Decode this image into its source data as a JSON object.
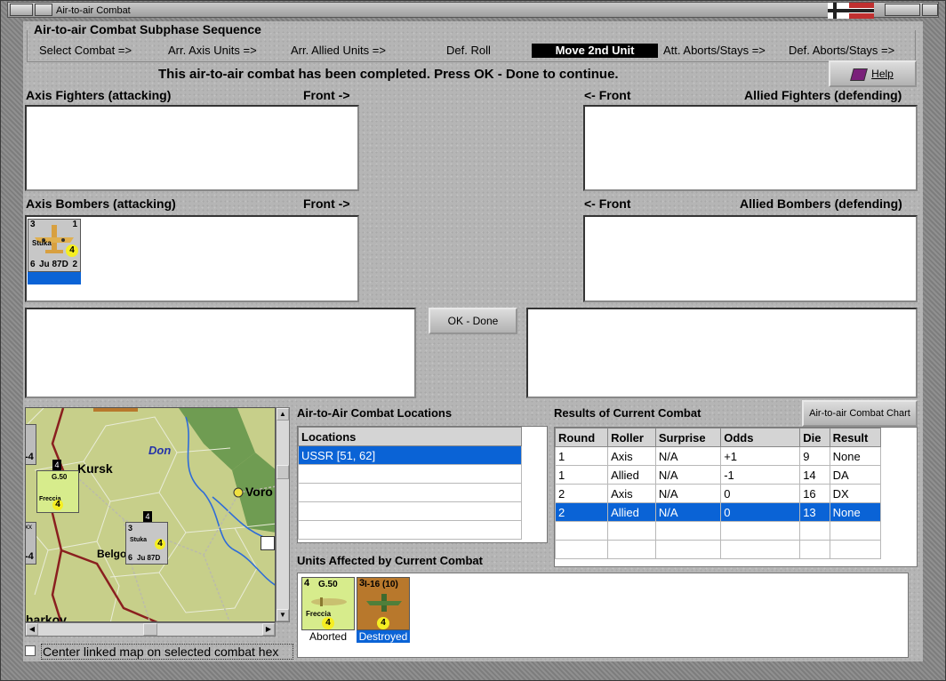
{
  "window": {
    "title": "Air-to-air Combat"
  },
  "sequence": {
    "heading": "Air-to-air Combat Subphase Sequence",
    "steps": [
      "Select Combat =>",
      "Arr. Axis Units =>",
      "Arr. Allied Units =>",
      "Def. Roll",
      "Move 2nd Unit",
      "Att. Aborts/Stays =>",
      "Def. Aborts/Stays =>"
    ],
    "active_step": "Move 2nd Unit"
  },
  "status_message": "This air-to-air combat has been completed.  Press OK - Done to continue.",
  "help_label": "Help",
  "panels": {
    "axis_fighters": "Axis Fighters (attacking)",
    "axis_bombers": "Axis Bombers (attacking)",
    "allied_fighters": "Allied Fighters (defending)",
    "allied_bombers": "Allied Bombers (defending)",
    "front_right": "Front ->",
    "front_left": "<- Front"
  },
  "axis_bomber_unit": {
    "class": "Stuka",
    "name": "Ju 87D",
    "top_left": "3",
    "top_right": "1",
    "bottom_left": "6",
    "bottom_right": "2",
    "value": "4"
  },
  "ok_done_label": "OK - Done",
  "map": {
    "labels": {
      "kursk": "Kursk",
      "don": "Don",
      "voro": "Voro",
      "belgo": "Belgo",
      "kharkov": "harkov"
    },
    "hex_counter_1": {
      "name": "G.50",
      "sub": "Freccia",
      "num": "4",
      "corner": "4"
    },
    "hex_counter_2": {
      "name": "Ju 87D",
      "class": "Stuka",
      "tl": "3",
      "tr": "1",
      "bl": "6",
      "value": "4",
      "corner": "4"
    },
    "edge_labels": {
      "a": "-4",
      "b": "-4",
      "c": "xx",
      "d": "3"
    }
  },
  "center_checkbox_label": "Center linked map on selected combat hex",
  "locations": {
    "heading": "Air-to-Air Combat Locations",
    "column": "Locations",
    "rows": [
      "USSR [51, 62]",
      "",
      "",
      "",
      ""
    ]
  },
  "results": {
    "heading": "Results of Current Combat",
    "chart_button": "Air-to-air Combat Chart",
    "columns": [
      "Round",
      "Roller",
      "Surprise",
      "Odds",
      "Die",
      "Result"
    ],
    "rows": [
      [
        "1",
        "Axis",
        "N/A",
        "+1",
        "9",
        "None"
      ],
      [
        "1",
        "Allied",
        "N/A",
        "-1",
        "14",
        "DA"
      ],
      [
        "2",
        "Axis",
        "N/A",
        "0",
        "16",
        "DX"
      ],
      [
        "2",
        "Allied",
        "N/A",
        "0",
        "13",
        "None"
      ],
      [
        "",
        "",
        "",
        "",
        "",
        ""
      ],
      [
        "",
        "",
        "",
        "",
        "",
        ""
      ]
    ],
    "selected_row": 3
  },
  "affected": {
    "heading": "Units Affected by Current Combat",
    "units": [
      {
        "name": "G.50",
        "sub": "Freccia",
        "tl": "4",
        "value": "4",
        "status": "Aborted"
      },
      {
        "name": "I-16 (10)",
        "tl": "3",
        "value": "4",
        "status": "Destroyed"
      }
    ]
  },
  "colors": {
    "selection": "#0a63d6",
    "italian_counter": "#d7ec8c",
    "soviet_counter": "#b8782c",
    "axis_counter": "#c7c7c7"
  }
}
